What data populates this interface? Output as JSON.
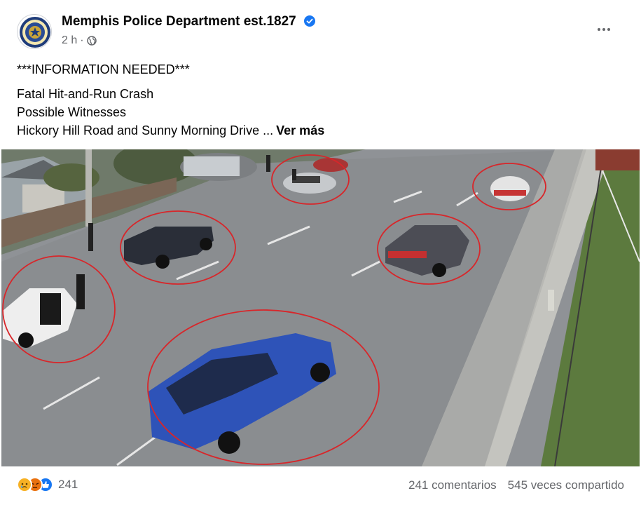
{
  "post": {
    "page_name": "Memphis Police Department est.1827",
    "time": "2 h",
    "audience_icon": "globe-icon",
    "verified_icon": "verified-badge-icon",
    "more_icon": "more-options-icon",
    "text": {
      "headline": "***INFORMATION NEEDED***",
      "line1": "Fatal Hit-and-Run Crash",
      "line2": "Possible Witnesses",
      "line3": "Hickory Hill Road and Sunny Morning Drive ...",
      "see_more": "Ver más"
    },
    "photo": {
      "description_icon": "street-surveillance-photo"
    }
  },
  "footer": {
    "reactions": [
      "sad-reaction-icon",
      "angry-reaction-icon",
      "like-reaction-icon"
    ],
    "reaction_count": "241",
    "comments": "241 comentarios",
    "shares": "545 veces compartido"
  },
  "colors": {
    "verified_blue": "#1877f2",
    "annotation_red": "#d8262a",
    "like_blue": "#1877f2",
    "angry_orange": "#e9710f",
    "sad_yellow": "#f7b125"
  }
}
